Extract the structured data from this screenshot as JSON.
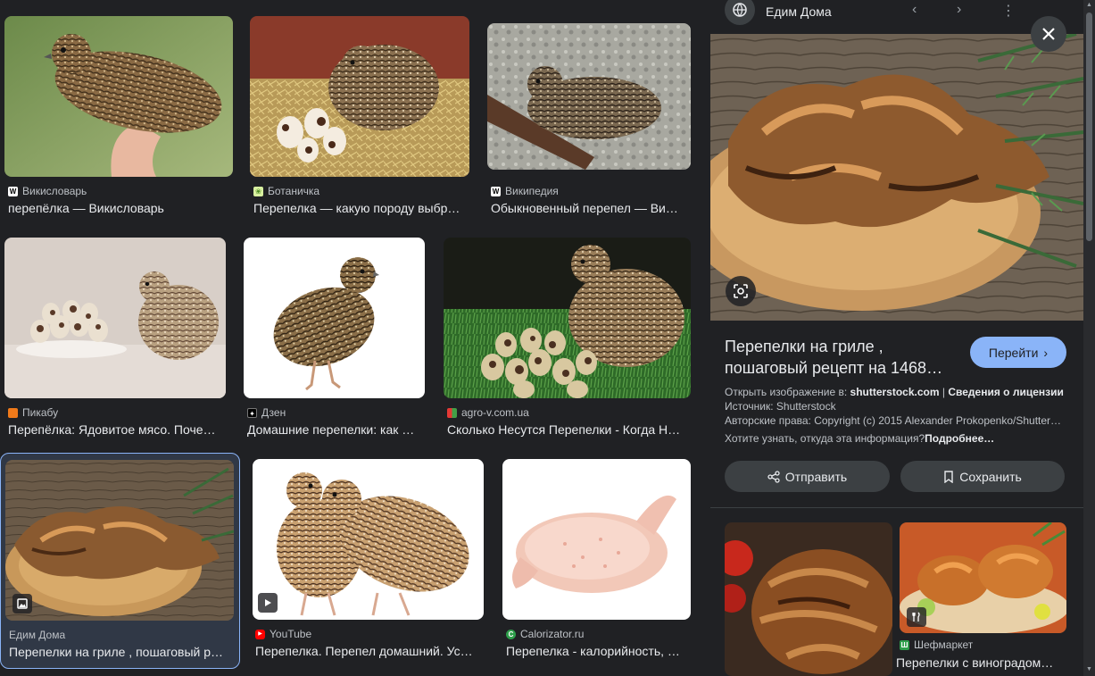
{
  "results": [
    {
      "source": "Викисловарь",
      "title": "перепёлка — Викисловарь",
      "fav_letter": "W",
      "fav_bg": "#ffffff",
      "fav_fg": "#000000"
    },
    {
      "source": "Ботаничка",
      "title": "Перепелка — какую породу выбр…",
      "fav_letter": "❀",
      "fav_bg": "#d8f0a0",
      "fav_fg": "#4a8a20"
    },
    {
      "source": "Википедия",
      "title": "Обыкновенный перепел — Ви…",
      "fav_letter": "W",
      "fav_bg": "#ffffff",
      "fav_fg": "#000000"
    },
    {
      "source": "Пикабу",
      "title": "Перепёлка: Ядовитое мясо. Поче…",
      "fav_letter": "",
      "fav_bg": "#f07a1a",
      "fav_fg": "#ffffff"
    },
    {
      "source": "Дзен",
      "title": "Домашние перепелки: как …",
      "fav_letter": "✦",
      "fav_bg": "#000000",
      "fav_fg": "#ffffff"
    },
    {
      "source": "agro-v.com.ua",
      "title": "Сколько Несутся Перепелки - Когда Н…",
      "fav_letter": "",
      "fav_bg": "#4caf50",
      "fav_fg": "#ffffff"
    },
    {
      "source": "Едим Дома",
      "title": "Перепелки на гриле , пошаговый р…",
      "fav_letter": "",
      "fav_bg": "",
      "fav_fg": ""
    },
    {
      "source": "YouTube",
      "title": "Перепелка. Перепел домашний. Ус…",
      "fav_letter": "▶",
      "fav_bg": "#ff0000",
      "fav_fg": "#ffffff"
    },
    {
      "source": "Calorizator.ru",
      "title": "Перепелка - калорийность, …",
      "fav_letter": "C",
      "fav_bg": "#2e9e4a",
      "fav_fg": "#ffffff"
    }
  ],
  "panel": {
    "site_name": "Едим Дома",
    "title_line1": "Перепелки на гриле ,",
    "title_line2": "пошаговый рецепт на 1468…",
    "go_button": "Перейти",
    "open_in_label": "Открыть изображение в: ",
    "open_in_site": "shutterstock.com",
    "separator": " | ",
    "license_link": "Сведения о лицензии",
    "source_line": "Источник: Shutterstock",
    "copyright_line": "Авторские права: Copyright (c) 2015 Alexander Prokopenko/Shutter…",
    "info_question": "Хотите узнать, откуда эта информация?",
    "info_more": "Подробнее…",
    "share_button": "Отправить",
    "save_button": "Сохранить",
    "related": [
      {
        "source": "",
        "title": ""
      },
      {
        "source": "Шефмаркет",
        "title": "Перепелки с виноградом…"
      }
    ]
  },
  "colors": {
    "accent": "#8ab4f8",
    "go_button_bg": "#8ab4f8",
    "go_button_fg": "#202124",
    "chip_bg": "#3c4043"
  }
}
